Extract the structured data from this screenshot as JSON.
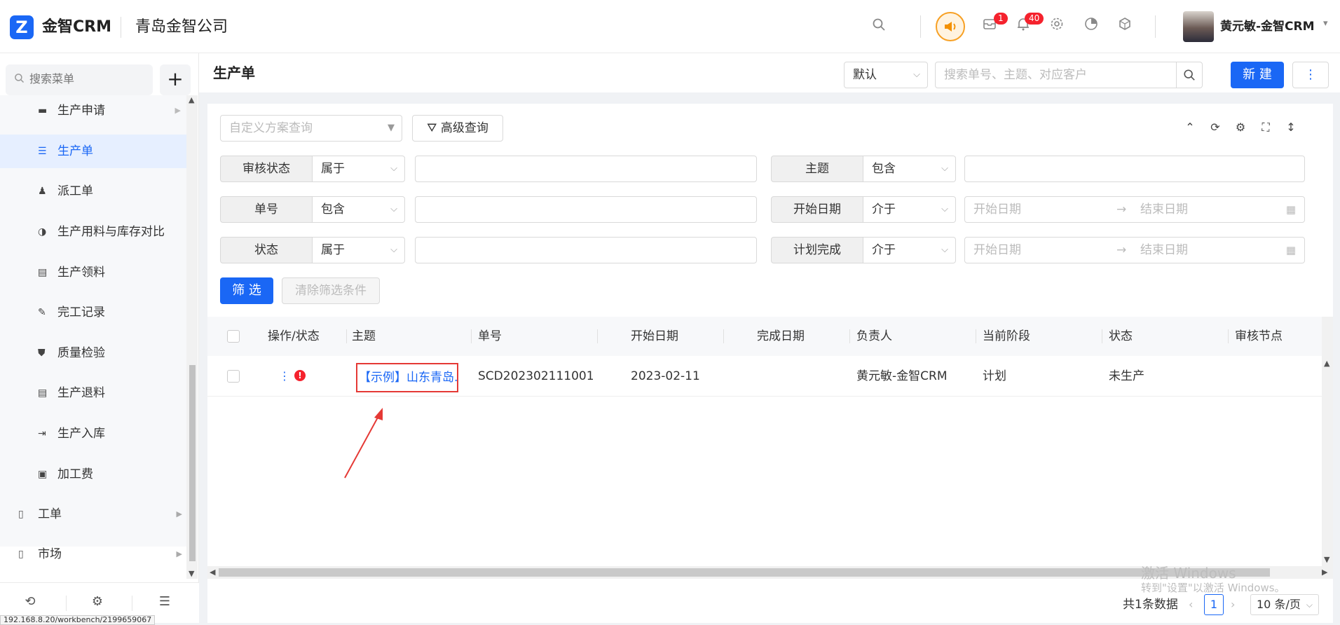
{
  "header": {
    "brand": "金智CRM",
    "company": "青岛金智公司",
    "notifications": {
      "messages_badge": "1",
      "alerts_badge": "40"
    },
    "user": "黄元敏-金智CRM",
    "icons": [
      "search-icon",
      "speaker-icon",
      "inbox-icon",
      "bell-icon",
      "gear-icon",
      "pie-chart-icon",
      "cube-icon"
    ]
  },
  "sidebar": {
    "search_placeholder": "搜索菜单",
    "sub_items": [
      {
        "label": "生产申请",
        "icon": "folder-icon"
      },
      {
        "label": "生产单",
        "icon": "list-icon",
        "active": true
      },
      {
        "label": "派工单",
        "icon": "worker-icon"
      },
      {
        "label": "生产用料与库存对比",
        "icon": "contrast-icon"
      },
      {
        "label": "生产领料",
        "icon": "doc-icon"
      },
      {
        "label": "完工记录",
        "icon": "edit-doc-icon"
      },
      {
        "label": "质量检验",
        "icon": "shield-icon"
      },
      {
        "label": "生产退料",
        "icon": "doc-icon"
      },
      {
        "label": "生产入库",
        "icon": "import-icon"
      },
      {
        "label": "加工费",
        "icon": "fee-icon"
      }
    ],
    "top_items": [
      {
        "label": "工单",
        "icon": "ticket-icon"
      },
      {
        "label": "市场",
        "icon": "bookmark-icon"
      }
    ],
    "status_url": "192.168.8.20/workbench/2199659067"
  },
  "main": {
    "title": "生产单",
    "view_select": "默认",
    "search_placeholder": "搜索单号、主题、对应客户",
    "new_button": "新 建",
    "more_button": "⋮"
  },
  "filters": {
    "scheme_placeholder": "自定义方案查询",
    "advanced_button": "高级查询",
    "rows": [
      {
        "label": "审核状态",
        "op": "属于"
      },
      {
        "label": "主题",
        "op": "包含"
      },
      {
        "label": "单号",
        "op": "包含"
      },
      {
        "label": "开始日期",
        "op": "介于",
        "start": "开始日期",
        "end": "结束日期"
      },
      {
        "label": "状态",
        "op": "属于"
      },
      {
        "label": "计划完成",
        "op": "介于",
        "start": "开始日期",
        "end": "结束日期"
      }
    ],
    "date_arrow": "→",
    "filter_button": "筛 选",
    "clear_button": "清除筛选条件"
  },
  "table": {
    "columns": [
      "操作/状态",
      "主题",
      "单号",
      "开始日期",
      "完成日期",
      "负责人",
      "当前阶段",
      "状态",
      "审核节点"
    ],
    "rows": [
      {
        "subject": "【示例】山东青岛...",
        "number": "SCD202302111001",
        "start_date": "2023-02-11",
        "end_date": "",
        "owner": "黄元敏-金智CRM",
        "stage": "计划",
        "status": "未生产",
        "audit_node": ""
      }
    ]
  },
  "pagination": {
    "total": "共1条数据",
    "page": "1",
    "page_size": "10 条/页"
  },
  "watermark": {
    "line1": "激活 Windows",
    "line2": "转到\"设置\"以激活 Windows。"
  },
  "colors": {
    "primary": "#1a67f5",
    "danger": "#f5222d",
    "highlight_box": "#e53935",
    "speaker": "#f39000"
  }
}
